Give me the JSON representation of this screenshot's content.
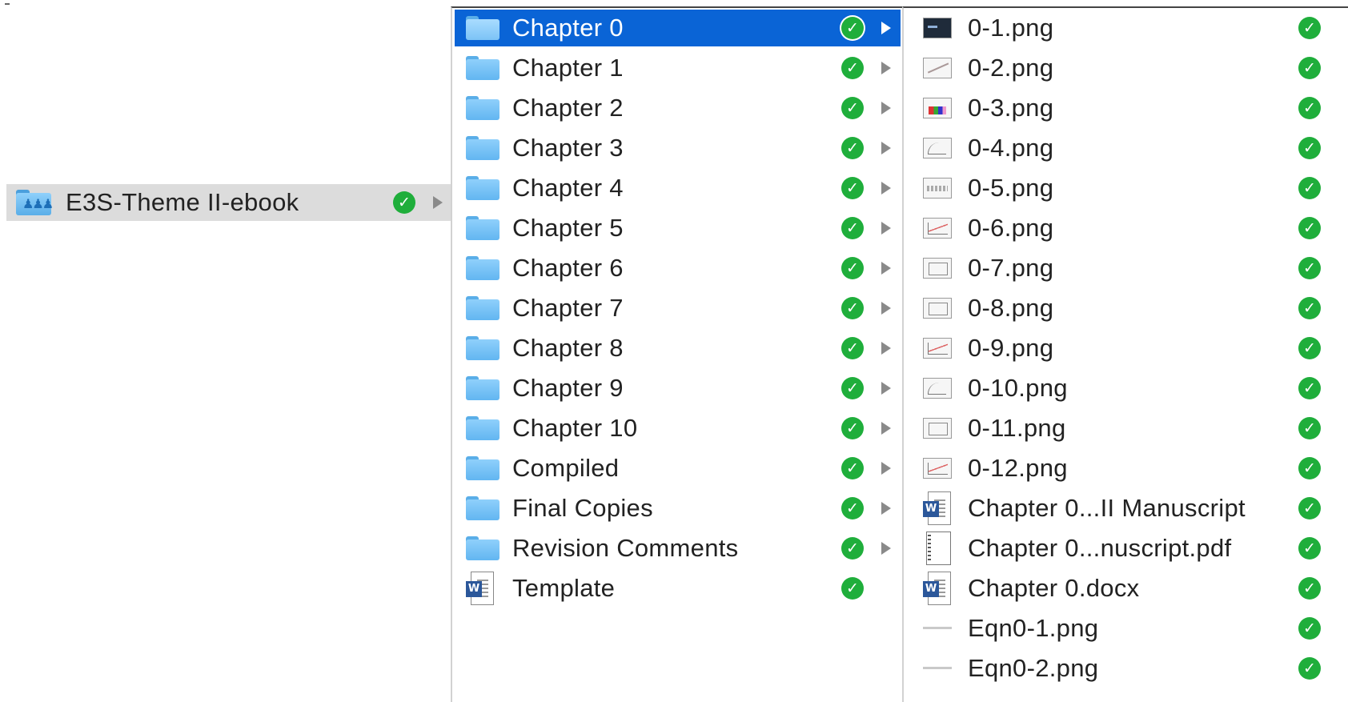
{
  "sync_status_icon": "green-checkmark-icon",
  "expand_icon": "disclosure-triangle-icon",
  "column1": {
    "items": [
      {
        "label": "E3S-Theme II-ebook",
        "icon": "shared-folder-icon"
      }
    ]
  },
  "column2": {
    "items": [
      {
        "label": "Chapter 0",
        "icon": "folder-icon"
      },
      {
        "label": "Chapter 1",
        "icon": "folder-icon"
      },
      {
        "label": "Chapter 2",
        "icon": "folder-icon"
      },
      {
        "label": "Chapter 3",
        "icon": "folder-icon"
      },
      {
        "label": "Chapter 4",
        "icon": "folder-icon"
      },
      {
        "label": "Chapter 5",
        "icon": "folder-icon"
      },
      {
        "label": "Chapter 6",
        "icon": "folder-icon"
      },
      {
        "label": "Chapter 7",
        "icon": "folder-icon"
      },
      {
        "label": "Chapter 8",
        "icon": "folder-icon"
      },
      {
        "label": "Chapter 9",
        "icon": "folder-icon"
      },
      {
        "label": "Chapter 10",
        "icon": "folder-icon"
      },
      {
        "label": "Compiled",
        "icon": "folder-icon"
      },
      {
        "label": "Final Copies",
        "icon": "folder-icon"
      },
      {
        "label": "Revision Comments",
        "icon": "folder-icon"
      },
      {
        "label": "Template",
        "icon": "word-document-icon"
      }
    ]
  },
  "column3": {
    "items": [
      {
        "label": "0-1.png",
        "icon": "image-thumbnail-icon"
      },
      {
        "label": "0-2.png",
        "icon": "image-thumbnail-icon"
      },
      {
        "label": "0-3.png",
        "icon": "image-thumbnail-icon"
      },
      {
        "label": "0-4.png",
        "icon": "image-thumbnail-icon"
      },
      {
        "label": "0-5.png",
        "icon": "image-thumbnail-icon"
      },
      {
        "label": "0-6.png",
        "icon": "image-thumbnail-icon"
      },
      {
        "label": "0-7.png",
        "icon": "image-thumbnail-icon"
      },
      {
        "label": "0-8.png",
        "icon": "image-thumbnail-icon"
      },
      {
        "label": "0-9.png",
        "icon": "image-thumbnail-icon"
      },
      {
        "label": "0-10.png",
        "icon": "image-thumbnail-icon"
      },
      {
        "label": "0-11.png",
        "icon": "image-thumbnail-icon"
      },
      {
        "label": "0-12.png",
        "icon": "image-thumbnail-icon"
      },
      {
        "label": "Chapter 0...II Manuscript",
        "icon": "word-document-icon"
      },
      {
        "label": "Chapter 0...nuscript.pdf",
        "icon": "pdf-document-icon"
      },
      {
        "label": "Chapter 0.docx",
        "icon": "word-document-icon"
      },
      {
        "label": "Eqn0-1.png",
        "icon": "image-thumbnail-icon"
      },
      {
        "label": "Eqn0-2.png",
        "icon": "image-thumbnail-icon"
      }
    ]
  },
  "colors": {
    "selection": "#0a64d6",
    "highlight": "#dcdcdc",
    "sync_check": "#1fae3b",
    "folder": "#62b6f1"
  }
}
